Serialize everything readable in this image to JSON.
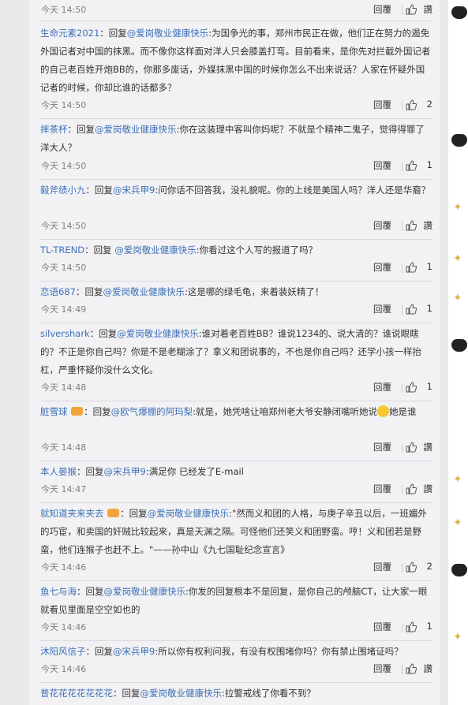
{
  "reply_label": "回覆",
  "comments": [
    {
      "user": "",
      "text": "",
      "time": "今天 14:50",
      "likes": "讚"
    },
    {
      "user": "生命元素2021",
      "reply_word": "回复",
      "at": "@爱岗敬业健康快乐",
      "text": ":为国争光的事，郑州市民正在做，他们正在努力的遏免外国记者对中国的抹黑。而不像你这样面对洋人只会膝盖打弯。目前看来，是你先对拦截外国记者的自己老百姓开炮BB的，你那多废话，外媒抹黑中国的时候你怎么不出来说话？人家在怀疑外国记者的时候，你却比谁的话都多？",
      "time": "今天 14:50",
      "likes": "2"
    },
    {
      "user": "摔茶杯",
      "reply_word": "回复",
      "at": "@爱岗敬业健康快乐",
      "text": ":你在这装理中客叫你妈呢？不就是个精神二鬼子，觉得得罪了洋大人？",
      "time": "今天 14:50",
      "likes": "1"
    },
    {
      "user": "毅斧绩小九",
      "reply_word": "回复",
      "at": "@宋兵甲9",
      "text": ":问你话不回答我，没礼貌呢。你的上线是美国人吗？洋人还是华裔？",
      "time": "今天 14:50",
      "likes": "讚"
    },
    {
      "user": "TL-TREND",
      "reply_word": "回复",
      "at": "@爱岗敬业健康快乐",
      "text": ":你看过这个人写的报道了吗？",
      "time": "今天 14:50",
      "likes": "1"
    },
    {
      "user": "恋语687",
      "reply_word": "回复",
      "at": "@爱岗敬业健康快乐",
      "text": ":这是哪的绿毛龟，来着装妖精了！",
      "time": "今天 14:49",
      "likes": "1"
    },
    {
      "user": "silvershark",
      "reply_word": "回复",
      "at": "@爱岗敬业健康快乐",
      "text": ":谁对着老百姓BB？谁说1234的、说大清的？谁说眼瞎的？不正是你自己吗？你是不是老糊涂了？拿义和团说事的，不也是你自己吗？还学小孩一样抬杠，严重怀疑你没什么文化。",
      "time": "今天 14:48",
      "likes": "1"
    },
    {
      "user": "脏雪球",
      "reply_word": "回复",
      "at": "@欧气爆棚的阿玛梨",
      "text": ":就是，她凭啥让咱郑州老大爷安静闭嘴听她说",
      "text2": "她是谁",
      "time": "今天 14:48",
      "likes": "讚"
    },
    {
      "user": "本人晏猴",
      "reply_word": "回复",
      "at": "@宋兵甲9",
      "text": ":满足你  已经发了E-mail",
      "time": "今天 14:47",
      "likes": "讚"
    },
    {
      "user": "就知道夹来夹去",
      "reply_word": "回复",
      "at": "@爱岗敬业健康快乐",
      "text": ":\"然而义和团的人格，与庚子辛丑以后，一班媚外的巧宦，和卖国的奸贼比较起来，真是天渊之隔。可怪他们还笑义和团野蛮。哼！义和团若是野蛮，他们连猴子也赶不上。\"——孙中山《九七国耻纪念宣言》",
      "time": "今天 14:46",
      "likes": "2"
    },
    {
      "user": "鱼七与海",
      "reply_word": "回复",
      "at": "@爱岗敬业健康快乐",
      "text": ":你发的回复根本不是回复，是你自己的颅脑CT，让大家一眼就看见里面是空空如也的",
      "time": "今天 14:46",
      "likes": "1"
    },
    {
      "user": "沐阳风信子",
      "reply_word": "回复",
      "at": "@宋兵甲9",
      "text": ":所以你有权利问我，有没有权围堵你吗？你有禁止围堵证吗？",
      "time": "今天 14:46",
      "likes": "讚"
    },
    {
      "user": "普花花花花花花花",
      "reply_word": "回复",
      "at": "@爱岗敬业健康快乐",
      "text": ":拉警戒线了你看不到？",
      "time": "",
      "likes": ""
    }
  ]
}
